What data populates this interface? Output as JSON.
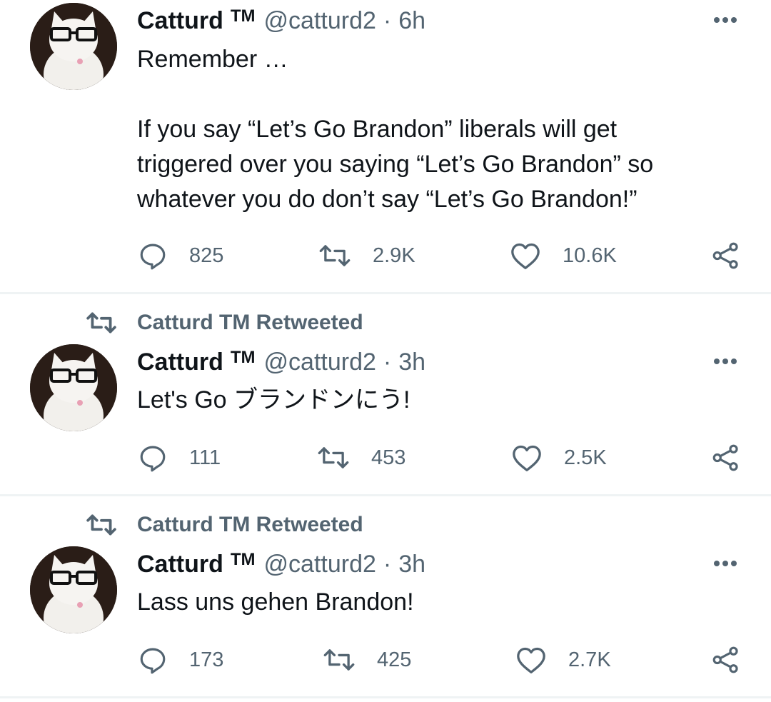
{
  "tweets": [
    {
      "retweeted_by": null,
      "name": "Catturd",
      "tm": "TM",
      "handle": "@catturd2",
      "dot": "·",
      "time": "6h",
      "text": "Remember …\n\nIf you say “Let’s Go Brandon” liberals will get\ntriggered over you saying “Let’s Go Brandon” so\nwhatever you do don’t say “Let’s Go Brandon!”",
      "replies": "825",
      "retweets": "2.9K",
      "likes": "10.6K",
      "icons": {
        "more": "more-icon",
        "reply": "reply-icon",
        "retweet": "retweet-icon",
        "like": "heart-icon",
        "share": "share-icon"
      }
    },
    {
      "retweeted_by": "Catturd TM Retweeted",
      "name": "Catturd",
      "tm": "TM",
      "handle": "@catturd2",
      "dot": "·",
      "time": "3h",
      "text": "Let's Go ブランドンにう!",
      "replies": "111",
      "retweets": "453",
      "likes": "2.5K"
    },
    {
      "retweeted_by": "Catturd TM Retweeted",
      "name": "Catturd",
      "tm": "TM",
      "handle": "@catturd2",
      "dot": "·",
      "time": "3h",
      "text": "Lass uns gehen Brandon!",
      "replies": "173",
      "retweets": "425",
      "likes": "2.7K"
    }
  ],
  "colors": {
    "text": "#0f1419",
    "secondary": "#536471",
    "divider": "#eff3f4",
    "background": "#ffffff"
  }
}
